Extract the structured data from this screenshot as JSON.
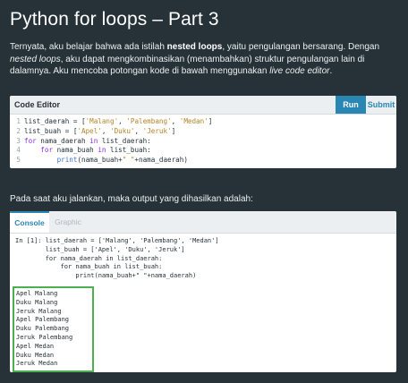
{
  "title": "Python for loops – Part 3",
  "intro": {
    "p1": "Ternyata, aku belajar bahwa ada istilah ",
    "b1": "nested loops",
    "p2": ", yaitu pengulangan bersarang. Dengan ",
    "i1": "nested loops",
    "p3": ", aku dapat mengkombinasikan (menambahkan) struktur pengulangan lain di dalamnya.  Aku mencoba potongan kode di bawah menggunakan ",
    "i2": "live code editor",
    "p4": "."
  },
  "editor": {
    "label": "Code Editor",
    "run_label": "Run",
    "submit_label": "Submit",
    "lines": [
      {
        "n": "1",
        "parts": [
          {
            "t": "list_daerah = [",
            "c": "src"
          },
          {
            "t": "'Malang'",
            "c": "str"
          },
          {
            "t": ", ",
            "c": "src"
          },
          {
            "t": "'Palembang'",
            "c": "str"
          },
          {
            "t": ", ",
            "c": "src"
          },
          {
            "t": "'Medan'",
            "c": "str"
          },
          {
            "t": "]",
            "c": "src"
          }
        ]
      },
      {
        "n": "2",
        "parts": [
          {
            "t": "list_buah = [",
            "c": "src"
          },
          {
            "t": "'Apel'",
            "c": "str"
          },
          {
            "t": ", ",
            "c": "src"
          },
          {
            "t": "'Duku'",
            "c": "str"
          },
          {
            "t": ", ",
            "c": "src"
          },
          {
            "t": "'Jeruk'",
            "c": "str"
          },
          {
            "t": "]",
            "c": "src"
          }
        ]
      },
      {
        "n": "3",
        "parts": [
          {
            "t": "for",
            "c": "kw"
          },
          {
            "t": " nama_daerah ",
            "c": "src"
          },
          {
            "t": "in",
            "c": "kw"
          },
          {
            "t": " list_daerah:",
            "c": "src"
          }
        ]
      },
      {
        "n": "4",
        "parts": [
          {
            "t": "    ",
            "c": "src"
          },
          {
            "t": "for",
            "c": "kw"
          },
          {
            "t": " nama_buah ",
            "c": "src"
          },
          {
            "t": "in",
            "c": "kw"
          },
          {
            "t": " list_buah:",
            "c": "src"
          }
        ]
      },
      {
        "n": "5",
        "parts": [
          {
            "t": "        ",
            "c": "src"
          },
          {
            "t": "print",
            "c": "fn"
          },
          {
            "t": "(nama_buah+",
            "c": "src"
          },
          {
            "t": "\" \"",
            "c": "str"
          },
          {
            "t": "+nama_daerah)",
            "c": "src"
          }
        ]
      }
    ]
  },
  "output_text": "Pada saat aku jalankan, maka output yang dihasilkan adalah:",
  "console": {
    "tabs": [
      "Console",
      "Graphic"
    ],
    "input_lines": [
      "In [1]: list_daerah = ['Malang', 'Palembang', 'Medan']",
      "        list_buah = ['Apel', 'Duku', 'Jeruk']",
      "        for nama_daerah in list_daerah:",
      "            for nama_buah in list_buah:",
      "                print(nama_buah+\" \"+nama_daerah)"
    ],
    "output_lines": [
      "Apel Malang",
      "Duku Malang",
      "Jeruk Malang",
      "Apel Palembang",
      "Duku Palembang",
      "Jeruk Palembang",
      "Apel Medan",
      "Duku Medan",
      "Jeruk Medan"
    ]
  },
  "colors": {
    "background": "#263238",
    "accent": "#2a86b3",
    "output_highlight": "#4caf50"
  }
}
